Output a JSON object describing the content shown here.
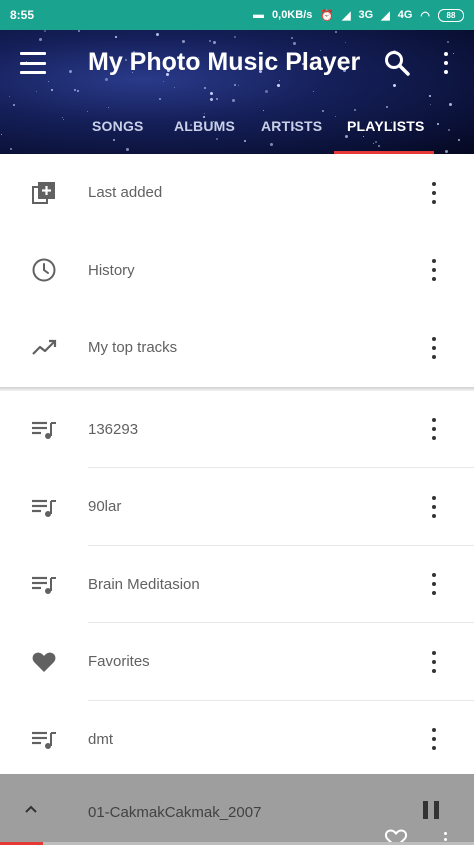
{
  "status_bar": {
    "time": "8:55",
    "speed": "0,0KB/s",
    "network_1": "3G",
    "network_2": "4G",
    "battery": "88"
  },
  "toolbar": {
    "title": "My Photo Music Player"
  },
  "tabs": [
    {
      "label": "SONGS",
      "active": false
    },
    {
      "label": "ALBUMS",
      "active": false
    },
    {
      "label": "ARTISTS",
      "active": false
    },
    {
      "label": "PLAYLISTS",
      "active": true
    }
  ],
  "smart_playlists": [
    {
      "label": "Last added",
      "icon": "playlist-add-icon"
    },
    {
      "label": "History",
      "icon": "history-icon"
    },
    {
      "label": "My top tracks",
      "icon": "trending-up-icon"
    }
  ],
  "playlists": [
    {
      "label": "136293",
      "icon": "playlist-icon"
    },
    {
      "label": "90lar",
      "icon": "playlist-icon"
    },
    {
      "label": "Brain Meditasion",
      "icon": "playlist-icon"
    },
    {
      "label": "Favorites",
      "icon": "heart-icon"
    },
    {
      "label": "dmt",
      "icon": "playlist-icon"
    }
  ],
  "now_playing": {
    "track": "01-CakmakCakmak_2007",
    "progress": 0.09
  },
  "colors": {
    "status_bar": "#1aa38f",
    "accent": "#e53935",
    "now_playing_bg": "#9e9e9e"
  }
}
